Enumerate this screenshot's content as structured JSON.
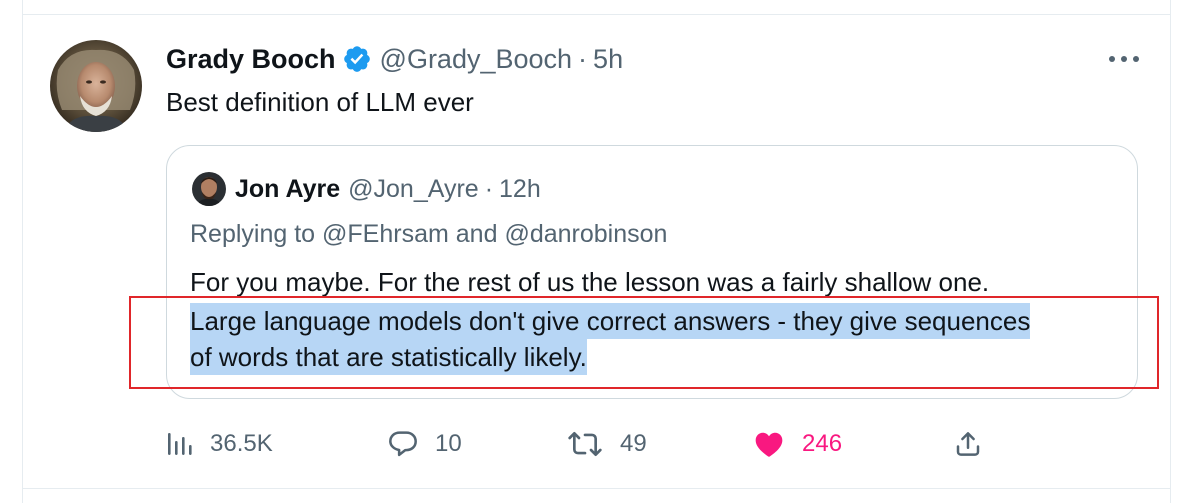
{
  "tweet": {
    "author_name": "Grady Booch",
    "author_handle": "@Grady_Booch",
    "separator": "·",
    "time": "5h",
    "text": "Best definition of LLM ever"
  },
  "quote": {
    "author_name": "Jon Ayre",
    "author_handle": "@Jon_Ayre",
    "separator": "·",
    "time": "12h",
    "replying_prefix": "Replying to",
    "replying_to_1": "@FEhrsam",
    "replying_and": "and",
    "replying_to_2": "@danrobinson",
    "line1": "For you maybe. For the rest of us the lesson was a fairly shallow one.",
    "highlight_line1": "Large language models don't give correct answers - they give sequences",
    "highlight_line2": "of words that are statistically likely."
  },
  "actions": {
    "views": "36.5K",
    "replies": "10",
    "retweets": "49",
    "likes": "246"
  },
  "colors": {
    "verified": "#1d9bf0",
    "like": "#f91880",
    "highlight": "#b7d6f5",
    "annotation_box": "#e0262a",
    "muted_text": "#536471"
  },
  "icons": {
    "verified": "verified-badge-icon",
    "more": "more-horizontal-icon",
    "views": "analytics-bars-icon",
    "reply": "reply-bubble-icon",
    "retweet": "retweet-icon",
    "like": "heart-filled-icon",
    "share": "share-upload-icon"
  }
}
